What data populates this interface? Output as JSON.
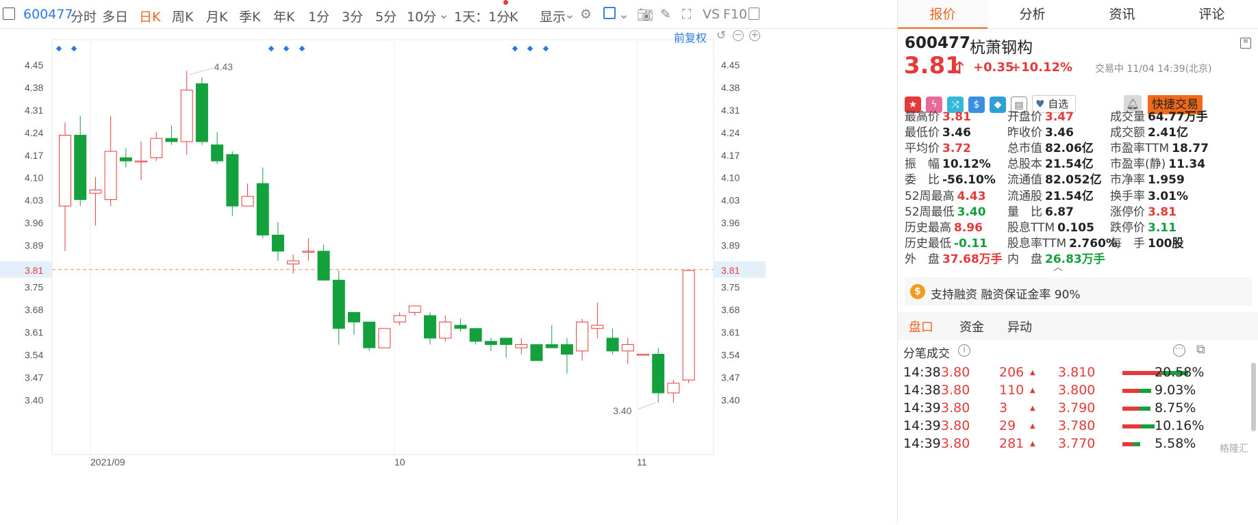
{
  "toolbar": {
    "code": "600477",
    "periods": [
      "分时",
      "多日",
      "日K",
      "周K",
      "月K",
      "季K",
      "年K",
      "1分",
      "3分",
      "5分",
      "10分"
    ],
    "active_period": "日K",
    "range_select": "1天：1分K",
    "display_label": "显示",
    "vs_label": "VS",
    "f10_label": "F10",
    "fq_label": "前复权"
  },
  "chart_data": {
    "type": "candlestick",
    "y_ticks": [
      "4.45",
      "4.38",
      "4.31",
      "4.24",
      "4.17",
      "4.10",
      "4.03",
      "3.96",
      "3.89",
      "3.81",
      "3.75",
      "3.68",
      "3.61",
      "3.54",
      "3.47",
      "3.40"
    ],
    "x_ticks": [
      "2021/09",
      "10",
      "11"
    ],
    "current_price": 3.81,
    "high_label": "4.43",
    "low_label": "3.40",
    "candles": [
      [
        4.01,
        4.23,
        4.27,
        3.87
      ],
      [
        4.23,
        4.03,
        4.29,
        4.01
      ],
      [
        4.05,
        4.06,
        4.1,
        3.95
      ],
      [
        4.03,
        4.18,
        4.29,
        4.01
      ],
      [
        4.16,
        4.15,
        4.19,
        4.13
      ],
      [
        4.15,
        4.15,
        4.21,
        4.09
      ],
      [
        4.16,
        4.22,
        4.24,
        4.15
      ],
      [
        4.22,
        4.21,
        4.26,
        4.2
      ],
      [
        4.21,
        4.37,
        4.43,
        4.17
      ],
      [
        4.39,
        4.21,
        4.41,
        4.2
      ],
      [
        4.2,
        4.15,
        4.24,
        4.14
      ],
      [
        4.17,
        4.01,
        4.18,
        3.98
      ],
      [
        4.01,
        4.04,
        4.08,
        4.01
      ],
      [
        4.08,
        3.92,
        4.13,
        3.91
      ],
      [
        3.92,
        3.87,
        3.96,
        3.84
      ],
      [
        3.83,
        3.84,
        3.86,
        3.8
      ],
      [
        3.87,
        3.87,
        3.91,
        3.84
      ],
      [
        3.87,
        3.78,
        3.89,
        3.78
      ],
      [
        3.78,
        3.63,
        3.81,
        3.58
      ],
      [
        3.68,
        3.65,
        3.68,
        3.61
      ],
      [
        3.65,
        3.57,
        3.65,
        3.56
      ],
      [
        3.57,
        3.63,
        3.63,
        3.57
      ],
      [
        3.65,
        3.67,
        3.68,
        3.64
      ],
      [
        3.68,
        3.7,
        3.7,
        3.67
      ],
      [
        3.67,
        3.6,
        3.68,
        3.58
      ],
      [
        3.6,
        3.65,
        3.67,
        3.59
      ],
      [
        3.64,
        3.63,
        3.66,
        3.62
      ],
      [
        3.63,
        3.59,
        3.63,
        3.58
      ],
      [
        3.59,
        3.58,
        3.6,
        3.56
      ],
      [
        3.6,
        3.58,
        3.6,
        3.54
      ],
      [
        3.57,
        3.58,
        3.6,
        3.55
      ],
      [
        3.58,
        3.53,
        3.58,
        3.53
      ],
      [
        3.58,
        3.57,
        3.64,
        3.57
      ],
      [
        3.58,
        3.55,
        3.6,
        3.49
      ],
      [
        3.56,
        3.65,
        3.66,
        3.53
      ],
      [
        3.63,
        3.64,
        3.71,
        3.6
      ],
      [
        3.6,
        3.56,
        3.63,
        3.55
      ],
      [
        3.56,
        3.58,
        3.6,
        3.52
      ],
      [
        3.55,
        3.55,
        3.55,
        3.55
      ],
      [
        3.55,
        3.43,
        3.57,
        3.4
      ],
      [
        3.43,
        3.46,
        3.47,
        3.4
      ],
      [
        3.47,
        3.81,
        3.81,
        3.46
      ]
    ],
    "markers_count": 8
  },
  "stock": {
    "code": "600477",
    "name": "杭萧钢构",
    "price": "3.81",
    "change": "+0.35",
    "change_pct": "+10.12%",
    "status": "交易中 11/04 14:39(北京)",
    "watch_label": "自选",
    "trade_label": "快捷交易"
  },
  "stats": [
    [
      [
        "最高价",
        "3.81",
        "red"
      ],
      [
        "开盘价",
        "3.47",
        "red"
      ],
      [
        "成交量",
        "64.77万手",
        "dark"
      ]
    ],
    [
      [
        "最低价",
        "3.46",
        "dark"
      ],
      [
        "昨收价",
        "3.46",
        "dark"
      ],
      [
        "成交额",
        "2.41亿",
        "dark"
      ]
    ],
    [
      [
        "平均价",
        "3.72",
        "red"
      ],
      [
        "总市值",
        "82.06亿",
        "dark"
      ],
      [
        "市盈率TTM",
        "18.77",
        "dark"
      ]
    ],
    [
      [
        "振　幅",
        "10.12%",
        "dark"
      ],
      [
        "总股本",
        "21.54亿",
        "dark"
      ],
      [
        "市盈率(静)",
        "11.34",
        "dark"
      ]
    ],
    [
      [
        "委　比",
        "-56.10%",
        "dark"
      ],
      [
        "流通值",
        "82.052亿",
        "dark"
      ],
      [
        "市净率",
        "1.959",
        "dark"
      ]
    ],
    [
      [
        "52周最高",
        "4.43",
        "red"
      ],
      [
        "流通股",
        "21.54亿",
        "dark"
      ],
      [
        "换手率",
        "3.01%",
        "dark"
      ]
    ],
    [
      [
        "52周最低",
        "3.40",
        "green"
      ],
      [
        "量　比",
        "6.87",
        "dark"
      ],
      [
        "涨停价",
        "3.81",
        "red"
      ]
    ],
    [
      [
        "历史最高",
        "8.96",
        "red"
      ],
      [
        "股息TTM",
        "0.105",
        "dark"
      ],
      [
        "跌停价",
        "3.11",
        "green"
      ]
    ],
    [
      [
        "历史最低",
        "-0.11",
        "green"
      ],
      [
        "股息率TTM",
        "2.760%",
        "dark"
      ],
      [
        "每　手",
        "100股",
        "dark"
      ]
    ],
    [
      [
        "外　盘",
        "37.68万手",
        "red"
      ],
      [
        "内　盘",
        "26.83万手",
        "green"
      ]
    ]
  ],
  "margin_text": "支持融资 融资保证金率 90%",
  "subtabs": [
    "盘口",
    "资金",
    "异动"
  ],
  "ticks_title": "分笔成交",
  "ticks": [
    {
      "time": "14:38",
      "price": "3.80",
      "vol": "206",
      "level": "3.810",
      "pct": "20.58%",
      "bar": 0.96
    },
    {
      "time": "14:38",
      "price": "3.80",
      "vol": "110",
      "level": "3.800",
      "pct": "9.03%",
      "bar": 0.42
    },
    {
      "time": "14:39",
      "price": "3.80",
      "vol": "3",
      "level": "3.790",
      "pct": "8.75%",
      "bar": 0.41
    },
    {
      "time": "14:39",
      "price": "3.80",
      "vol": "29",
      "level": "3.780",
      "pct": "10.16%",
      "bar": 0.47
    },
    {
      "time": "14:39",
      "price": "3.80",
      "vol": "281",
      "level": "3.770",
      "pct": "5.58%",
      "bar": 0.26
    }
  ],
  "watermark": "格隆汇"
}
